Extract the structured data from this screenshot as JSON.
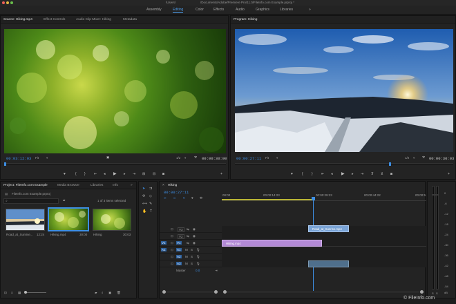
{
  "window": {
    "title_left": "/Users/",
    "title_right": "/Documents/Adobe/Premiere Pro/11.0/FileInfo.com Example.prproj *"
  },
  "workspaces": [
    {
      "label": "Assembly"
    },
    {
      "label": "Editing"
    },
    {
      "label": "Color"
    },
    {
      "label": "Effects"
    },
    {
      "label": "Audio"
    },
    {
      "label": "Graphics"
    },
    {
      "label": "Libraries"
    },
    {
      "label": "»"
    }
  ],
  "source": {
    "tabs": [
      "Source: Hiking.mp4",
      "Effect Controls",
      "Audio Clip Mixer: Hiking",
      "Metadata"
    ],
    "timecode": "00:03:12:03",
    "fit": "Fit",
    "resolution": "1/2",
    "duration": "00:00:30:00"
  },
  "program": {
    "tab": "Program: Hiking",
    "timecode": "00:00:27:11",
    "fit": "Fit",
    "resolution": "1/2",
    "duration": "00:00:30:03"
  },
  "project": {
    "tabs": [
      "Project: FileInfo.com Example",
      "Media Browser",
      "Libraries",
      "Info"
    ],
    "project_file": "FileInfo.com Example.prproj",
    "selection": "1 of 3 items selected",
    "items": [
      {
        "name": "Road_at_Sunrise...",
        "duration": "12:24"
      },
      {
        "name": "Hiking.mp4",
        "duration": "30:00"
      },
      {
        "name": "Hiking",
        "duration": "30:03"
      }
    ]
  },
  "timeline": {
    "tab": "Hiking",
    "timecode": "00:00:27:11",
    "ruler": [
      "00:00",
      "00:00:14:23",
      "00:00:29:23",
      "00:00:44:22",
      "00:00:5"
    ],
    "tracks": [
      {
        "label": "V3",
        "src": ""
      },
      {
        "label": "V2",
        "src": ""
      },
      {
        "label": "V1",
        "src": "V1"
      },
      {
        "label": "A1",
        "src": "A1"
      },
      {
        "label": "A2",
        "src": ""
      },
      {
        "label": "A3",
        "src": ""
      }
    ],
    "master": {
      "label": "Master",
      "value": "0.0"
    },
    "clips": [
      {
        "name": "Road_at_Sunrise.mp4",
        "track": "V2"
      },
      {
        "name": "Hiking.mp4",
        "track": "V1"
      },
      {
        "name": "",
        "track": "A3"
      }
    ]
  },
  "meter": {
    "ticks": [
      "0",
      "-6",
      "-12",
      "-18",
      "-24",
      "-30",
      "-36",
      "-42",
      "-48",
      "-54"
    ],
    "bottom": [
      "dB",
      "S",
      "S"
    ]
  },
  "watermark": "© FileInfo.com",
  "colors": {
    "accent": "#3d8ee3",
    "clip_v1": "#b38ad6",
    "clip_v2": "#7aa4d6",
    "clip_a3": "#4f6f8c"
  }
}
